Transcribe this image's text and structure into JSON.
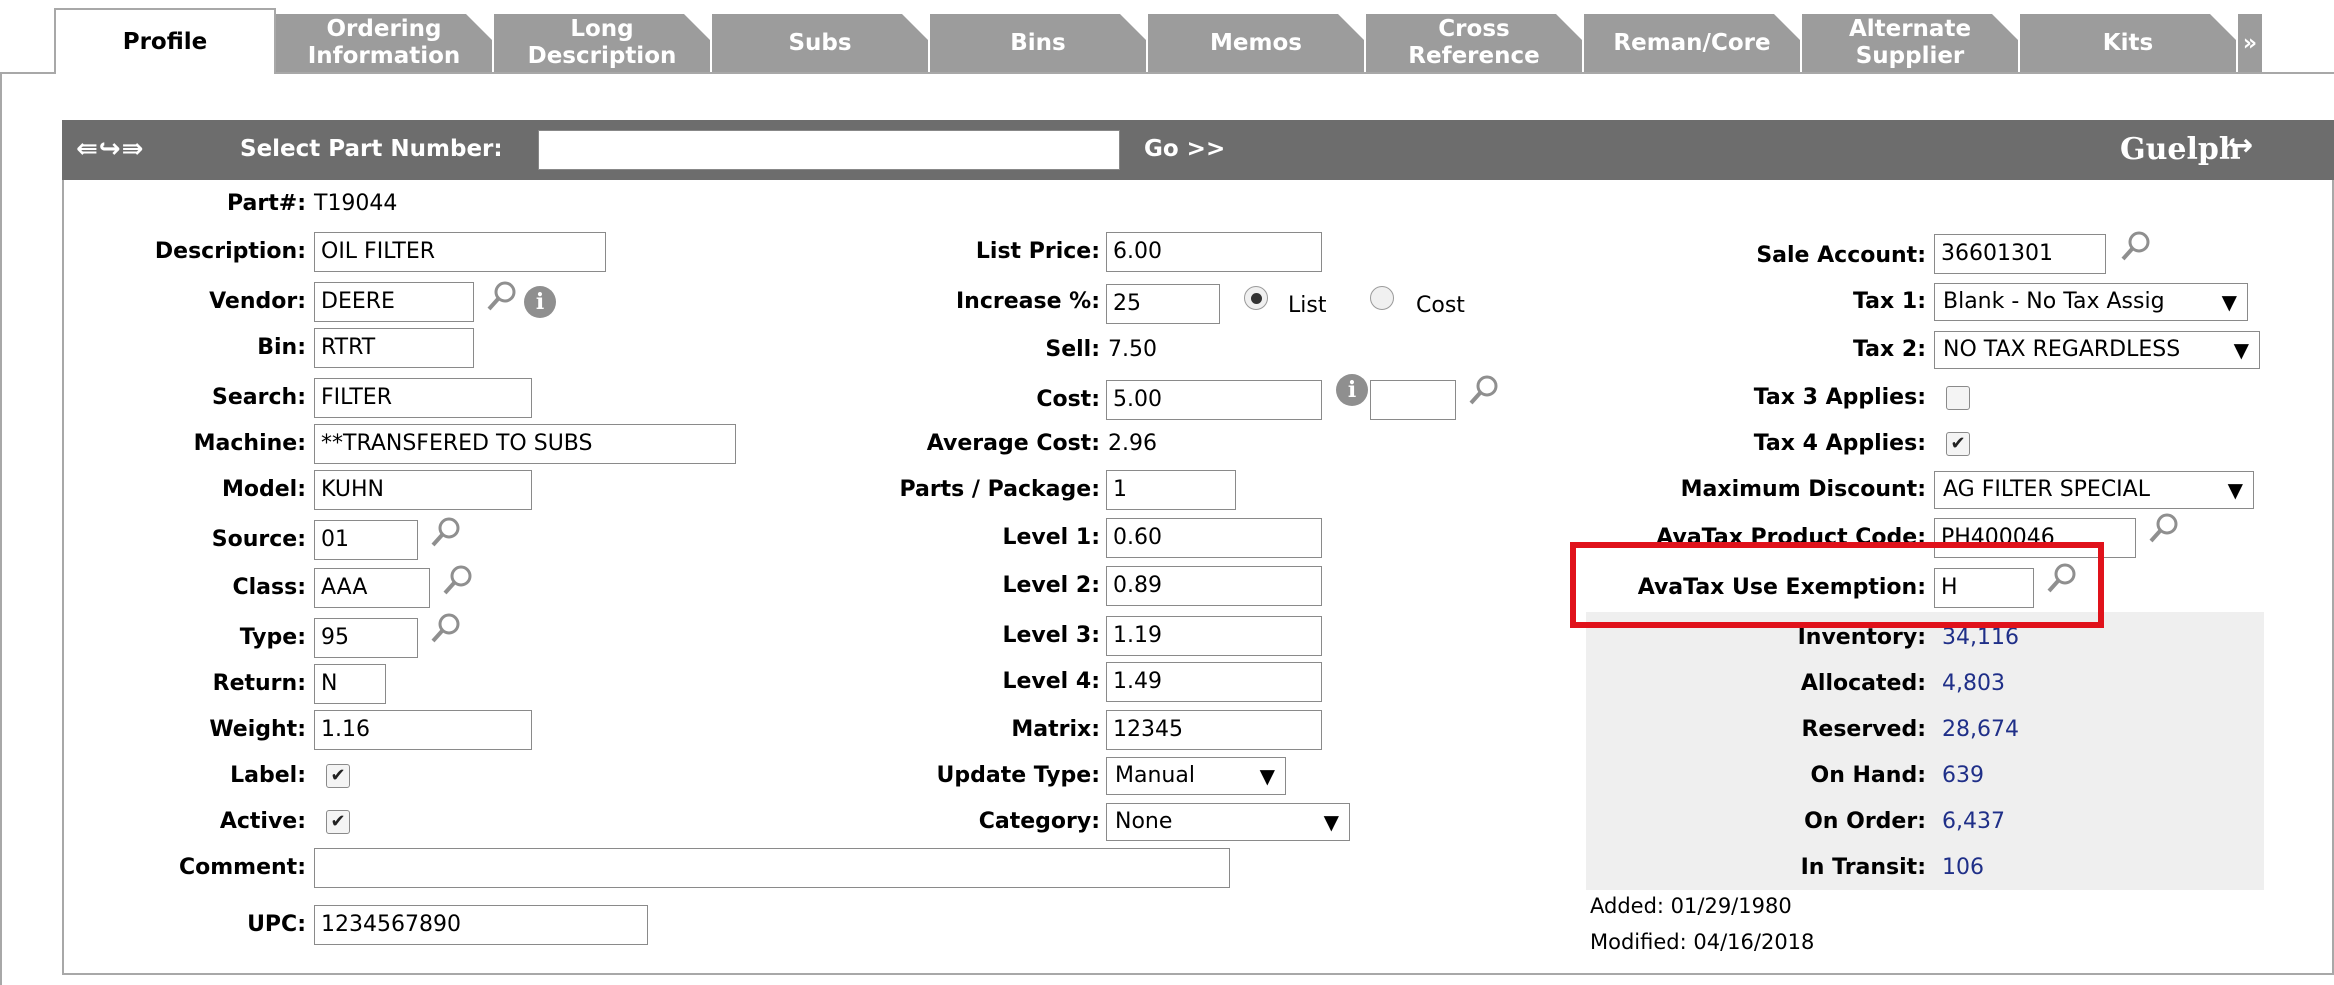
{
  "tabs": [
    {
      "label": "Profile",
      "active": true
    },
    {
      "label": "Ordering\nInformation"
    },
    {
      "label": "Long\nDescription"
    },
    {
      "label": "Subs"
    },
    {
      "label": "Bins"
    },
    {
      "label": "Memos"
    },
    {
      "label": "Cross\nReference"
    },
    {
      "label": "Reman/Core"
    },
    {
      "label": "Alternate\nSupplier"
    },
    {
      "label": "Kits"
    },
    {
      "label": "»"
    }
  ],
  "header": {
    "select_label": "Select Part Number:",
    "select_value": "",
    "go_label": "Go >>",
    "branch": "Guelph"
  },
  "left": {
    "part_label": "Part#:",
    "part_value": "T19044",
    "description_label": "Description:",
    "description_value": "OIL FILTER",
    "vendor_label": "Vendor:",
    "vendor_value": "DEERE",
    "bin_label": "Bin:",
    "bin_value": "RTRT",
    "search_label": "Search:",
    "search_value": "FILTER",
    "machine_label": "Machine:",
    "machine_value": "**TRANSFERED TO SUBS",
    "model_label": "Model:",
    "model_value": " KUHN",
    "source_label": "Source:",
    "source_value": "01",
    "class_label": "Class:",
    "class_value": "AAA",
    "type_label": "Type:",
    "type_value": "95",
    "return_label": "Return:",
    "return_value": "N",
    "weight_label": "Weight:",
    "weight_value": "1.16",
    "label_label": "Label:",
    "label_checked": true,
    "active_label": "Active:",
    "active_checked": true,
    "comment_label": "Comment:",
    "comment_value": "",
    "upc_label": "UPC:",
    "upc_value": "1234567890"
  },
  "middle": {
    "list_price_label": "List Price:",
    "list_price_value": "6.00",
    "increase_label": "Increase %:",
    "increase_value": "25",
    "radio_list_label": "List",
    "radio_cost_label": "Cost",
    "radio_selected": "List",
    "sell_label": "Sell:",
    "sell_value": "7.50",
    "cost_label": "Cost:",
    "cost_value": "5.00",
    "cost_extra_value": "",
    "avg_cost_label": "Average Cost:",
    "avg_cost_value": "2.96",
    "parts_pkg_label": "Parts / Package:",
    "parts_pkg_value": "1",
    "level1_label": "Level 1:",
    "level1_value": "0.60",
    "level2_label": "Level 2:",
    "level2_value": "0.89",
    "level3_label": "Level 3:",
    "level3_value": "1.19",
    "level4_label": "Level 4:",
    "level4_value": "1.49",
    "matrix_label": "Matrix:",
    "matrix_value": "12345",
    "update_type_label": "Update Type:",
    "update_type_value": "Manual",
    "category_label": "Category:",
    "category_value": "None"
  },
  "right": {
    "sale_account_label": "Sale Account:",
    "sale_account_value": "36601301",
    "tax1_label": "Tax 1:",
    "tax1_value": "Blank - No Tax Assig",
    "tax2_label": "Tax 2:",
    "tax2_value": "NO TAX REGARDLESS",
    "tax3_label": "Tax 3 Applies:",
    "tax3_checked": false,
    "tax4_label": "Tax 4 Applies:",
    "tax4_checked": true,
    "max_discount_label": "Maximum Discount:",
    "max_discount_value": "AG FILTER SPECIAL",
    "avatax_code_label": "AvaTax Product Code:",
    "avatax_code_value": "PH400046",
    "avatax_exempt_label": "AvaTax Use Exemption:",
    "avatax_exempt_value": "H",
    "inventory_label": "Inventory:",
    "inventory_value": "34,116",
    "allocated_label": "Allocated:",
    "allocated_value": "4,803",
    "reserved_label": "Reserved:",
    "reserved_value": "28,674",
    "onhand_label": "On Hand:",
    "onhand_value": "639",
    "onorder_label": "On Order:",
    "onorder_value": "6,437",
    "intransit_label": "In Transit:",
    "intransit_value": "106",
    "added": "Added: 01/29/1980",
    "modified": "Modified: 04/16/2018"
  },
  "colors": {
    "header_bg": "#6d6d6d",
    "tab_bg": "#9c9c9c",
    "highlight": "#e0121b",
    "value_blue": "#1f2f88"
  }
}
